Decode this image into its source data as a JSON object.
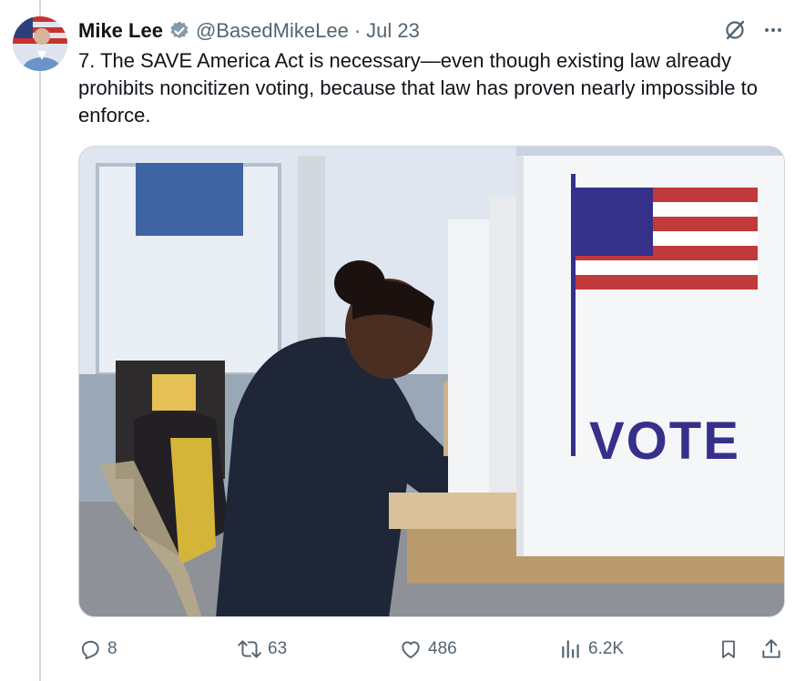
{
  "author": {
    "name": "Mike Lee",
    "handle": "@BasedMikeLee",
    "separator": "·",
    "date": "Jul 23"
  },
  "tweet_text": "7. The SAVE America Act is necessary—even though existing law already prohibits noncitizen voting, because that law has proven nearly impossible to enforce.",
  "media": {
    "booth_sign": "VOTE"
  },
  "actions": {
    "replies": "8",
    "reposts": "63",
    "likes": "486",
    "views": "6.2K"
  },
  "colors": {
    "text": "#0f1419",
    "muted": "#536471",
    "verified": "#829aab",
    "border": "#cfd9de",
    "vote_sign": "#35308a"
  }
}
